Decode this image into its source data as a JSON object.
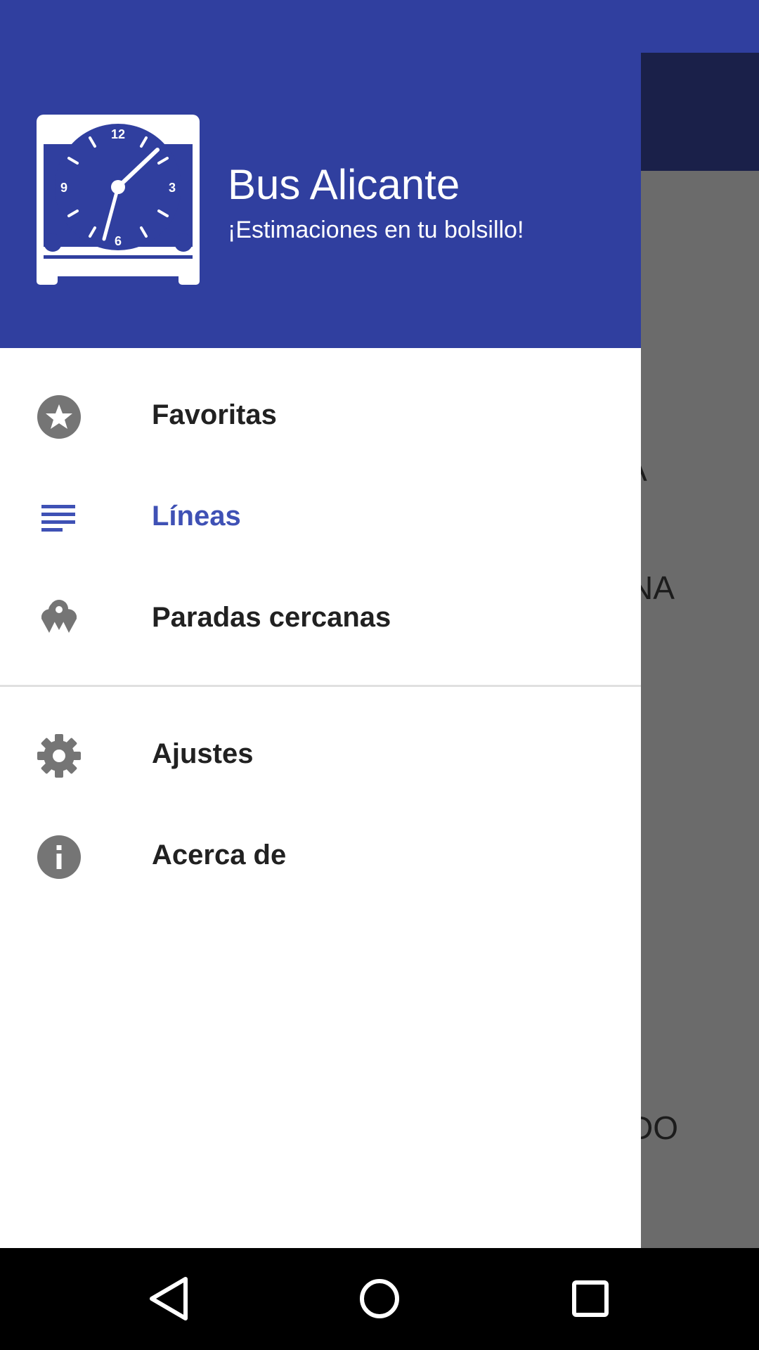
{
  "app": {
    "title": "Bus Alicante",
    "subtitle": "¡Estimaciones en tu bolsillo!"
  },
  "colors": {
    "primary": "#303f9f",
    "primary_dark": "#1a2049",
    "accent_active": "#3f51b5",
    "icon_gray": "#757575",
    "scrim": "#6b6b6b"
  },
  "drawer": {
    "items": [
      {
        "label": "Favoritas",
        "icon": "star-icon",
        "active": false
      },
      {
        "label": "Líneas",
        "icon": "list-icon",
        "active": true
      },
      {
        "label": "Paradas cercanas",
        "icon": "location-pins-icon",
        "active": false
      },
      {
        "label": "Ajustes",
        "icon": "gear-icon",
        "active": false
      },
      {
        "label": "Acerca de",
        "icon": "info-icon",
        "active": false
      }
    ]
  },
  "background": {
    "texts": [
      "A",
      "NA",
      "DO"
    ]
  },
  "navbar": {
    "buttons": [
      "back-icon",
      "home-icon",
      "recents-icon"
    ]
  }
}
